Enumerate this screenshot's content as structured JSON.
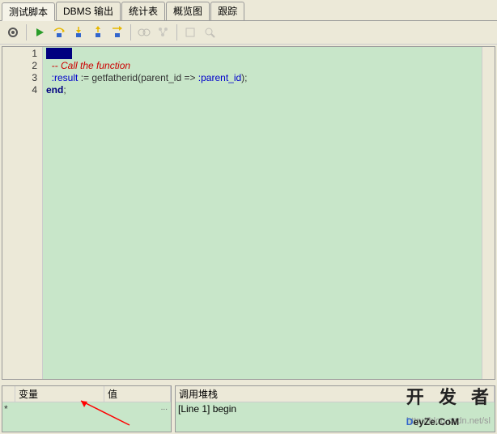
{
  "tabs": {
    "t0": "测试脚本",
    "t1": "DBMS 输出",
    "t2": "统计表",
    "t3": "概览图",
    "t4": "跟踪"
  },
  "toolbar": {
    "gear": "gear",
    "run": "run",
    "step_over": "step-over",
    "step_into": "step-into",
    "step_out": "step-out",
    "run_to": "run-to-cursor",
    "glasses": "watch",
    "tree": "call-tree",
    "search": "search",
    "zoom": "zoom"
  },
  "editor": {
    "lines": {
      "n1": "1",
      "n2": "2",
      "n3": "3",
      "n4": "4"
    },
    "code": {
      "l1": "begin",
      "l2_comment": "-- Call the function",
      "l3_var": ":result",
      "l3_assign": " := getfatherid(parent_id => ",
      "l3_var2": ":parent_id",
      "l3_end": ");",
      "l4": "end",
      "l4_semi": ";"
    }
  },
  "bottom": {
    "vars_panel": {
      "col1": "变量",
      "col2": "值"
    },
    "stack_panel": {
      "title": "调用堆栈",
      "line1": "[Line 1] begin"
    },
    "row_marker": "*",
    "dots": "..."
  },
  "watermark": {
    "url": "http://blog.csdn.net/sl",
    "logo_top": "开 发 者",
    "logo_d": "D",
    "logo_rest": "eyZe.CoM"
  }
}
